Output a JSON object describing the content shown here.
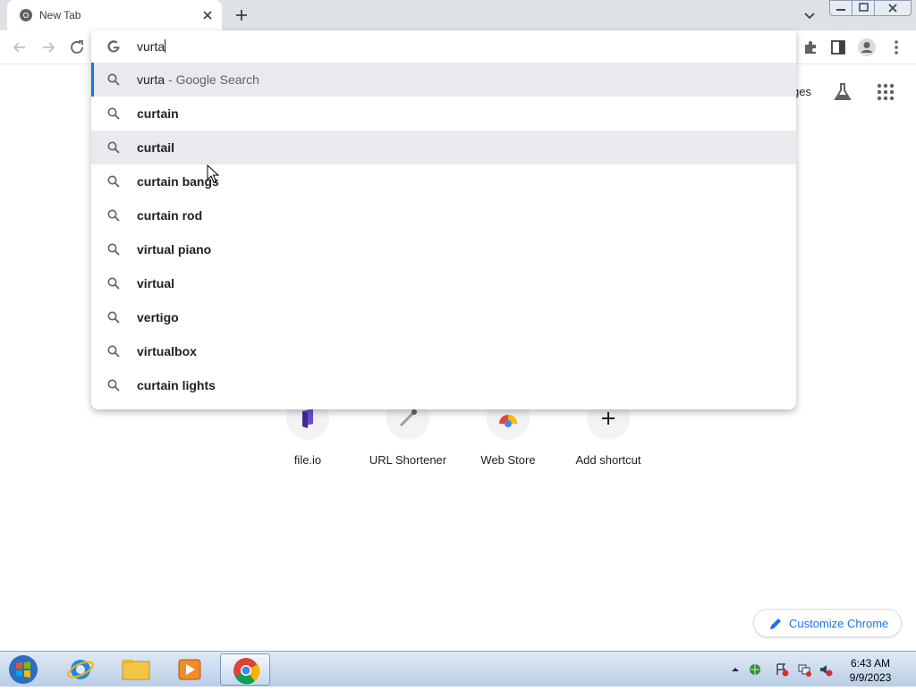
{
  "tab": {
    "title": "New Tab",
    "favicon": "chrome-icon",
    "close_icon": "close-icon"
  },
  "tabstrip": {
    "new_tab_icon": "plus-icon",
    "tab_search_icon": "chevron-down-icon"
  },
  "window_controls": [
    "minimize-icon",
    "maximize-icon",
    "close-icon"
  ],
  "toolbar": {
    "back_icon": "arrow-left-icon",
    "forward_icon": "arrow-right-icon",
    "reload_icon": "reload-icon",
    "right_icons": [
      "extensions-icon",
      "side-panel-icon",
      "profile-icon",
      "menu-icon"
    ]
  },
  "omnibox": {
    "value": "vurta",
    "suggestions": [
      {
        "text": "vurta",
        "suffix": " - Google Search",
        "bold": false
      },
      {
        "text": "curtain",
        "suffix": "",
        "bold": true
      },
      {
        "text": "curtail",
        "suffix": "",
        "bold": true
      },
      {
        "text": "curtain bangs",
        "suffix": "",
        "bold": true
      },
      {
        "text": "curtain rod",
        "suffix": "",
        "bold": true
      },
      {
        "text": "virtual piano",
        "suffix": "",
        "bold": true
      },
      {
        "text": "virtual",
        "suffix": "",
        "bold": true
      },
      {
        "text": "vertigo",
        "suffix": "",
        "bold": true
      },
      {
        "text": "virtualbox",
        "suffix": "",
        "bold": true
      },
      {
        "text": "curtain lights",
        "suffix": "",
        "bold": true
      }
    ]
  },
  "ntp": {
    "images_partial": "ges",
    "shortcuts": [
      {
        "label": "file.io",
        "icon": "file-io-icon"
      },
      {
        "label": "URL Shortener",
        "icon": "link-icon"
      },
      {
        "label": "Web Store",
        "icon": "chrome-web-store-icon"
      },
      {
        "label": "Add shortcut",
        "icon": "plus-icon"
      }
    ],
    "customize_label": "Customize Chrome"
  },
  "taskbar": {
    "time": "6:43 AM",
    "date": "9/9/2023",
    "apps": [
      "internet-explorer-icon",
      "file-explorer-icon",
      "media-player-icon",
      "chrome-icon"
    ]
  },
  "colors": {
    "accent": "#1a73e8",
    "selected_row": "#e8eaed",
    "tabstrip": "#dee1e6"
  }
}
